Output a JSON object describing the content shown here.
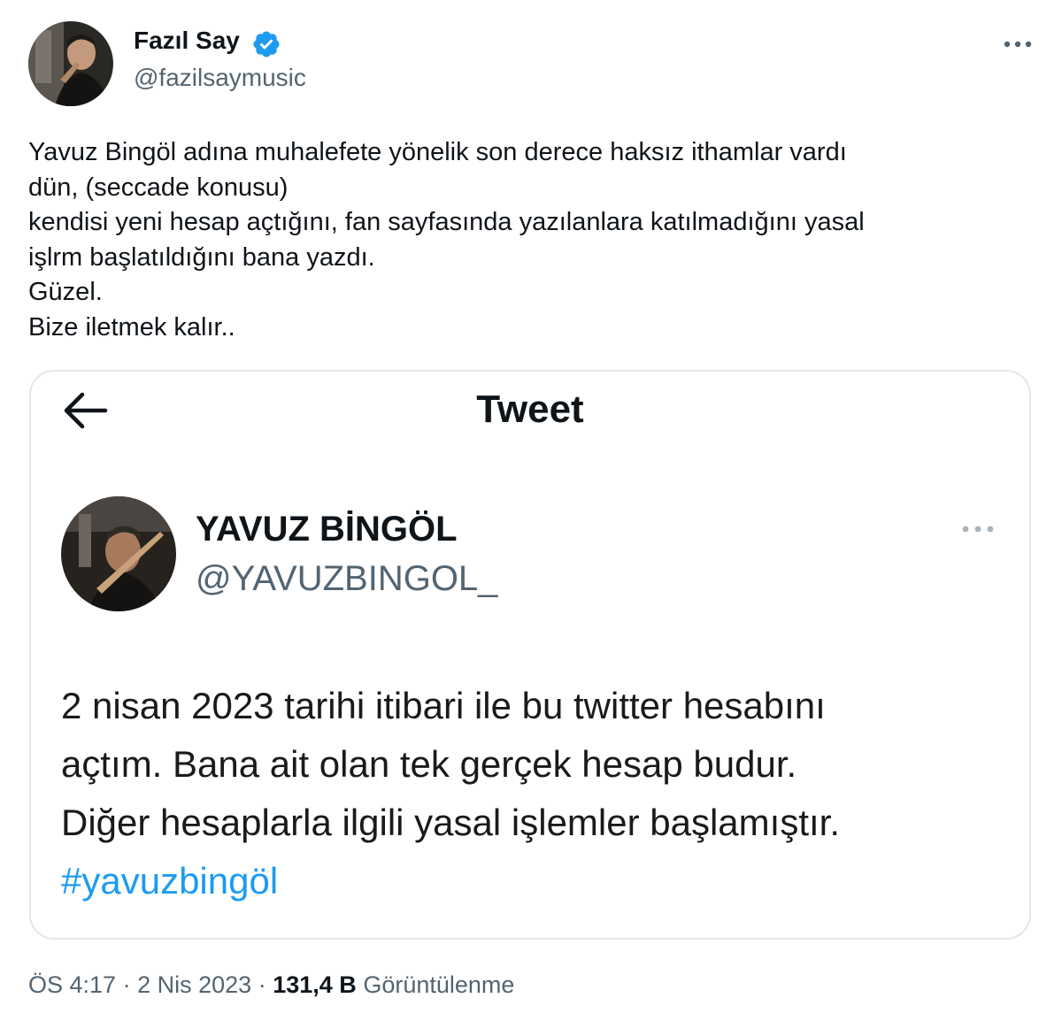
{
  "author": {
    "display_name": "Fazıl Say",
    "handle": "@fazilsaymusic",
    "verified_icon": "verified-badge-icon",
    "accent_color": "#1d9bf0"
  },
  "tweet": {
    "lines": [
      "Yavuz Bingöl adına muhalefete yönelik son derece haksız ithamlar vardı",
      "dün, (seccade konusu)",
      "kendisi yeni hesap açtığını, fan sayfasında yazılanlara katılmadığını yasal",
      "işlrm başlatıldığını bana yazdı.",
      "Güzel.",
      "Bize iletmek kalır.."
    ]
  },
  "embedded": {
    "header_title": "Tweet",
    "back_icon": "back-arrow-icon",
    "author_name": "YAVUZ BİNGÖL",
    "author_handle": "@YAVUZBINGOL_",
    "more_icon": "more-dots-icon",
    "body_lines": [
      "2 nisan 2023 tarihi itibari ile bu twitter hesabını",
      "açtım. Bana ait olan tek gerçek hesap budur.",
      "Diğer hesaplarla ilgili yasal işlemler başlamıştır."
    ],
    "hashtag": "#yavuzbingöl"
  },
  "meta": {
    "time": "ÖS 4:17",
    "separator": "·",
    "date": "2 Nis 2023",
    "views_count": "131,4 B",
    "views_label": "Görüntülenme"
  }
}
